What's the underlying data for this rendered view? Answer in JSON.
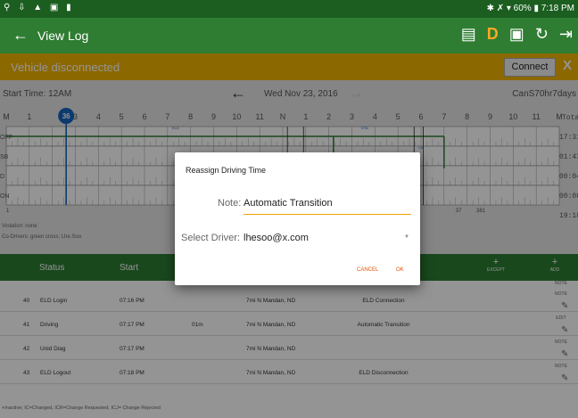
{
  "status_bar": {
    "left_icons": "⚲ ⇩ ▲ ▣ ▮",
    "right": "✱ ✗ ▾ 60% ▮ 7:18 PM"
  },
  "app_bar": {
    "title": "View Log",
    "icon_names": [
      "messages-icon",
      "duty-status-d-icon",
      "inspection-icon",
      "refresh-icon",
      "logout-icon"
    ],
    "d_label": "D"
  },
  "banner": {
    "message": "Vehicle disconnected",
    "connect_label": "Connect",
    "close_label": "X",
    "color": "#f2b300"
  },
  "log_header": {
    "start_time": "Start Time: 12AM",
    "date": "Wed Nov 23, 2016",
    "cycle": "CanS70hr7days"
  },
  "grid": {
    "hour_labels": [
      "M",
      "1",
      "",
      "3",
      "4",
      "5",
      "6",
      "7",
      "8",
      "9",
      "10",
      "11",
      "N",
      "1",
      "2",
      "3",
      "4",
      "5",
      "6",
      "7",
      "8",
      "9",
      "10",
      "11",
      "M"
    ],
    "current_hour_badge": "36",
    "rows": [
      "OFF",
      "SB",
      "D",
      "ON"
    ],
    "total_label": "Total",
    "totals": [
      "17:31",
      "01:43",
      "00:04",
      "00:08",
      "19:18"
    ],
    "marks": [
      "ELD",
      "DTA",
      "LA",
      "37",
      "381"
    ],
    "bottom_hour": "1"
  },
  "violation": "Violation: none",
  "co_drivers": "Co-Drivers: green cross; Lhe.Soo",
  "table": {
    "headers": {
      "status": "Status",
      "start": "Start"
    },
    "actions": [
      {
        "symbol": "+",
        "label": "EXCEPT"
      },
      {
        "symbol": "+",
        "label": "ADD"
      }
    ],
    "top_note": "NOTE",
    "rows": [
      {
        "id": "40",
        "status": "ELD Login",
        "start": "07:16 PM",
        "duration": "",
        "location": "7mi N Mandan, ND",
        "note": "ELD Connection",
        "action": "NOTE"
      },
      {
        "id": "41",
        "status": "Driving",
        "start": "07:17 PM",
        "duration": "01m",
        "location": "7mi N Mandan, ND",
        "note": "Automatic Transition",
        "action": "EDIT"
      },
      {
        "id": "42",
        "status": "Unid Diag",
        "start": "07:17 PM",
        "duration": "",
        "location": "7mi N Mandan, ND",
        "note": "",
        "action": "NOTE"
      },
      {
        "id": "43",
        "status": "ELD Logout",
        "start": "07:18 PM",
        "duration": "",
        "location": "7mi N Mandan, ND",
        "note": "ELD Disconnection",
        "action": "NOTE"
      }
    ]
  },
  "legend": "+Inactive; IC=Changed, ICR=Change Requested, ICJ= Change Rejected",
  "dialog": {
    "title": "Reassign Driving Time",
    "note_label": "Note:",
    "note_value": "Automatic Transition",
    "driver_label": "Select Driver:",
    "driver_value": "lhesoo@x.com",
    "cancel_label": "CANCEL",
    "ok_label": "OK"
  },
  "colors": {
    "primary": "#2e7d32",
    "accent": "#e65100",
    "warning": "#f2b300"
  }
}
